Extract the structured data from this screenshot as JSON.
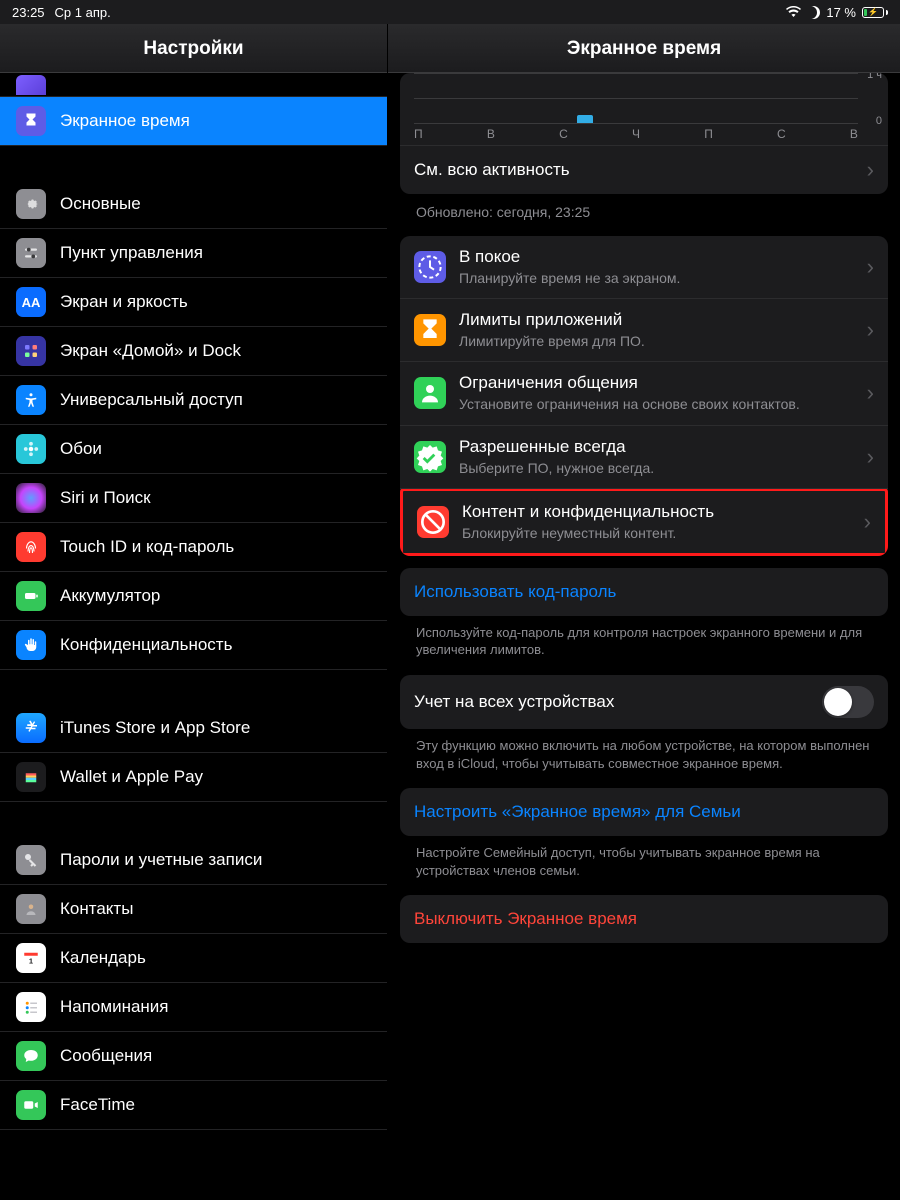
{
  "status": {
    "time": "23:25",
    "date": "Ср 1 апр.",
    "battery": "17 %"
  },
  "sidebar": {
    "title": "Настройки",
    "selected": "Экранное время",
    "items": [
      {
        "label": "Основные",
        "color": "#8e8e93"
      },
      {
        "label": "Пункт управления",
        "color": "#8e8e93"
      },
      {
        "label": "Экран и яркость",
        "color": "#0a6cff"
      },
      {
        "label": "Экран «Домой» и Dock",
        "color": "#3a3dcb"
      },
      {
        "label": "Универсальный доступ",
        "color": "#0a84ff"
      },
      {
        "label": "Обои",
        "color": "#28c7d9"
      },
      {
        "label": "Siri и Поиск",
        "color": "#2a2a2c"
      },
      {
        "label": "Touch ID и код-пароль",
        "color": "#ff3b30"
      },
      {
        "label": "Аккумулятор",
        "color": "#34c759"
      },
      {
        "label": "Конфиденциальность",
        "color": "#0a84ff"
      }
    ],
    "group2": [
      {
        "label": "iTunes Store и App Store",
        "color": "#0a84ff"
      },
      {
        "label": "Wallet и Apple Pay",
        "color": "#2a2a2c"
      }
    ],
    "group3": [
      {
        "label": "Пароли и учетные записи",
        "color": "#8e8e93"
      },
      {
        "label": "Контакты",
        "color": "#8e8e93"
      },
      {
        "label": "Календарь",
        "color": "#fff"
      },
      {
        "label": "Напоминания",
        "color": "#fff"
      },
      {
        "label": "Сообщения",
        "color": "#34c759"
      },
      {
        "label": "FaceTime",
        "color": "#34c759"
      }
    ]
  },
  "detail": {
    "title": "Экранное время",
    "chart_days": [
      "П",
      "В",
      "С",
      "Ч",
      "П",
      "С",
      "В"
    ],
    "chart_y": [
      "1 ч",
      "0"
    ],
    "see_all": "См. всю активность",
    "updated": "Обновлено: сегодня, 23:25",
    "options": [
      {
        "title": "В покое",
        "sub": "Планируйте время не за экраном.",
        "color": "#5e5ce6"
      },
      {
        "title": "Лимиты приложений",
        "sub": "Лимитируйте время для ПО.",
        "color": "#ff9500"
      },
      {
        "title": "Ограничения общения",
        "sub": "Установите ограничения на основе своих контактов.",
        "color": "#30d158"
      },
      {
        "title": "Разрешенные всегда",
        "sub": "Выберите ПО, нужное всегда.",
        "color": "#30d158"
      },
      {
        "title": "Контент и конфиденциальность",
        "sub": "Блокируйте неуместный контент.",
        "color": "#ff3b30"
      }
    ],
    "passcode": "Использовать код-пароль",
    "passcode_sub": "Используйте код-пароль для контроля настроек экранного времени и для увеличения лимитов.",
    "alldev": "Учет на всех устройствах",
    "alldev_sub": "Эту функцию можно включить на любом устройстве, на котором выполнен вход в iCloud, чтобы учитывать совместное экранное время.",
    "family": "Настроить «Экранное время» для Семьи",
    "family_sub": "Настройте Семейный доступ, чтобы учитывать экранное время на устройствах членов семьи.",
    "turnoff": "Выключить Экранное время"
  },
  "chart_data": {
    "type": "bar",
    "categories": [
      "П",
      "В",
      "С",
      "Ч",
      "П",
      "С",
      "В"
    ],
    "values": [
      0,
      0,
      0.15,
      0,
      0,
      0,
      0
    ],
    "ylabel": "",
    "ylim": [
      0,
      1
    ],
    "yticks": [
      "0",
      "1 ч"
    ]
  }
}
